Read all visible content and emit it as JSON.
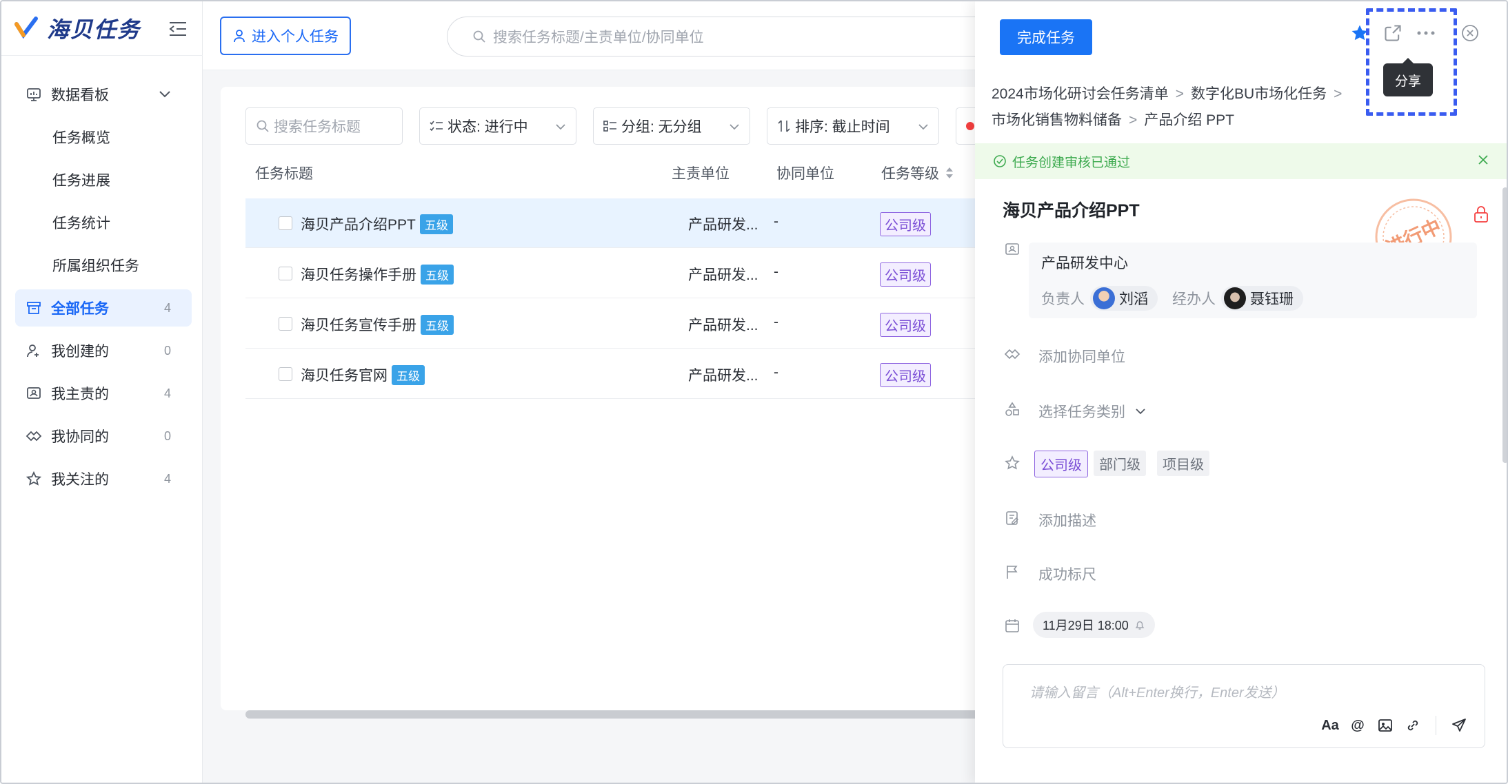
{
  "app": {
    "name": "海贝任务"
  },
  "sidebar": {
    "items": [
      {
        "label": "数据看板",
        "type": "group"
      },
      {
        "label": "任务概览",
        "type": "sub"
      },
      {
        "label": "任务进展",
        "type": "sub"
      },
      {
        "label": "任务统计",
        "type": "sub"
      },
      {
        "label": "所属组织任务",
        "type": "sub"
      },
      {
        "label": "全部任务",
        "count": "4",
        "active": true
      },
      {
        "label": "我创建的",
        "count": "0"
      },
      {
        "label": "我主责的",
        "count": "4"
      },
      {
        "label": "我协同的",
        "count": "0"
      },
      {
        "label": "我关注的",
        "count": "4"
      }
    ]
  },
  "topbar": {
    "personal_button": "进入个人任务",
    "search_placeholder": "搜索任务标题/主责单位/协同单位"
  },
  "filters": {
    "search_placeholder": "搜索任务标题",
    "status": "状态: 进行中",
    "group": "分组: 无分组",
    "sort": "排序: 截止时间"
  },
  "table": {
    "headers": [
      "任务标题",
      "主责单位",
      "协同单位",
      "任务等级"
    ],
    "rows": [
      {
        "title": "海贝产品介绍PPT",
        "level_badge": "五级",
        "unit": "产品研发...",
        "co": "-",
        "grade": "公司级"
      },
      {
        "title": "海贝任务操作手册",
        "level_badge": "五级",
        "unit": "产品研发...",
        "co": "-",
        "grade": "公司级"
      },
      {
        "title": "海贝任务宣传手册",
        "level_badge": "五级",
        "unit": "产品研发...",
        "co": "-",
        "grade": "公司级"
      },
      {
        "title": "海贝任务官网",
        "level_badge": "五级",
        "unit": "产品研发...",
        "co": "-",
        "grade": "公司级"
      }
    ]
  },
  "drawer": {
    "complete_button": "完成任务",
    "tooltip": "分享",
    "breadcrumb": [
      "2024市场化研讨会任务清单",
      "数字化BU市场化任务",
      "市场化销售物料储备",
      "产品介绍 PPT"
    ],
    "notice": "任务创建审核已通过",
    "title": "海贝产品介绍PPT",
    "stamp": "进行中",
    "org": "产品研发中心",
    "owner_role": "负责人",
    "owner_name": "刘滔",
    "handler_role": "经办人",
    "handler_name": "聂钰珊",
    "add_collab": "添加协同单位",
    "select_category": "选择任务类别",
    "levels": [
      "公司级",
      "部门级",
      "项目级"
    ],
    "add_desc": "添加描述",
    "success_ruler": "成功标尺",
    "date": "11月29日 18:00",
    "comment_placeholder": "请输入留言（Alt+Enter换行，Enter发送）",
    "font_tool": "Aa",
    "mention_tool": "@"
  },
  "colors": {
    "primary": "#1a74f5",
    "level_purple": "#7b4fd6",
    "success": "#3daa4f",
    "badge_blue": "#3aa3e8"
  }
}
